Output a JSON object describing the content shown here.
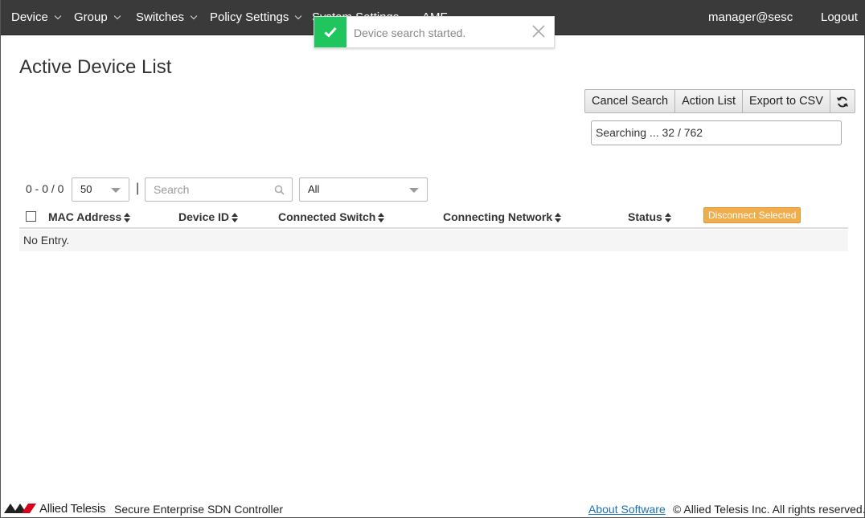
{
  "nav": {
    "items": [
      {
        "label": "Device"
      },
      {
        "label": "Group"
      },
      {
        "label": "Switches"
      },
      {
        "label": "Policy Settings"
      },
      {
        "label": "System Settings"
      },
      {
        "label": "AMF"
      }
    ],
    "user": "manager@sesc",
    "logout": "Logout"
  },
  "toast": {
    "message": "Device search started.",
    "icon": "check-icon",
    "color": "#21c55d"
  },
  "page": {
    "title": "Active Device List"
  },
  "toolbar": {
    "cancel_search": "Cancel Search",
    "action_list": "Action List",
    "export_csv": "Export to CSV",
    "refresh_icon": "refresh-icon"
  },
  "progress": {
    "text": "Searching ... 32 / 762"
  },
  "filters": {
    "range": "0 - 0 / 0",
    "page_size": "50",
    "separator": "|",
    "search_placeholder": "Search",
    "status_filter": "All"
  },
  "table": {
    "columns": [
      "MAC Address",
      "Device ID",
      "Connected Switch",
      "Connecting Network",
      "Status"
    ],
    "disconnect_selected": "Disconnect Selected",
    "empty": "No Entry."
  },
  "footer": {
    "brand": "Allied Telesis",
    "product": "Secure Enterprise SDN Controller",
    "about": "About Software",
    "copyright": "© Allied Telesis Inc. All rights reserved."
  },
  "colors": {
    "navbar": "#3a3a3a",
    "accent_orange": "#f0ad4e",
    "link": "#1a6fb5"
  }
}
